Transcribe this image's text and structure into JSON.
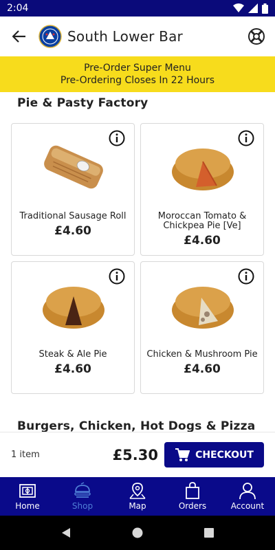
{
  "status_bar": {
    "time": "2:04"
  },
  "header": {
    "title": "South Lower Bar"
  },
  "banner": {
    "line1": "Pre-Order Super Menu",
    "line2": "Pre-Ordering Closes In 22 Hours"
  },
  "sections": [
    {
      "title": "Pie & Pasty Factory",
      "products": [
        {
          "name": "Traditional Sausage Roll",
          "price": "£4.60"
        },
        {
          "name": "Moroccan Tomato & Chickpea Pie [Ve]",
          "price": "£4.60"
        },
        {
          "name": "Steak & Ale Pie",
          "price": "£4.60"
        },
        {
          "name": "Chicken & Mushroom Pie",
          "price": "£4.60"
        }
      ]
    },
    {
      "title": "Burgers, Chicken, Hot Dogs & Pizza"
    }
  ],
  "basket": {
    "count": "1 item",
    "total": "£5.30",
    "checkout_label": "CHECKOUT"
  },
  "nav": [
    {
      "label": "Home",
      "icon": "stadium-icon",
      "active": false
    },
    {
      "label": "Shop",
      "icon": "food-icon",
      "active": true
    },
    {
      "label": "Map",
      "icon": "map-pin-icon",
      "active": false
    },
    {
      "label": "Orders",
      "icon": "bag-icon",
      "active": false
    },
    {
      "label": "Account",
      "icon": "person-icon",
      "active": false
    }
  ],
  "colors": {
    "brand": "#0a0a8a",
    "banner": "#f7dc1c",
    "active_tab": "#4f7fd6"
  }
}
